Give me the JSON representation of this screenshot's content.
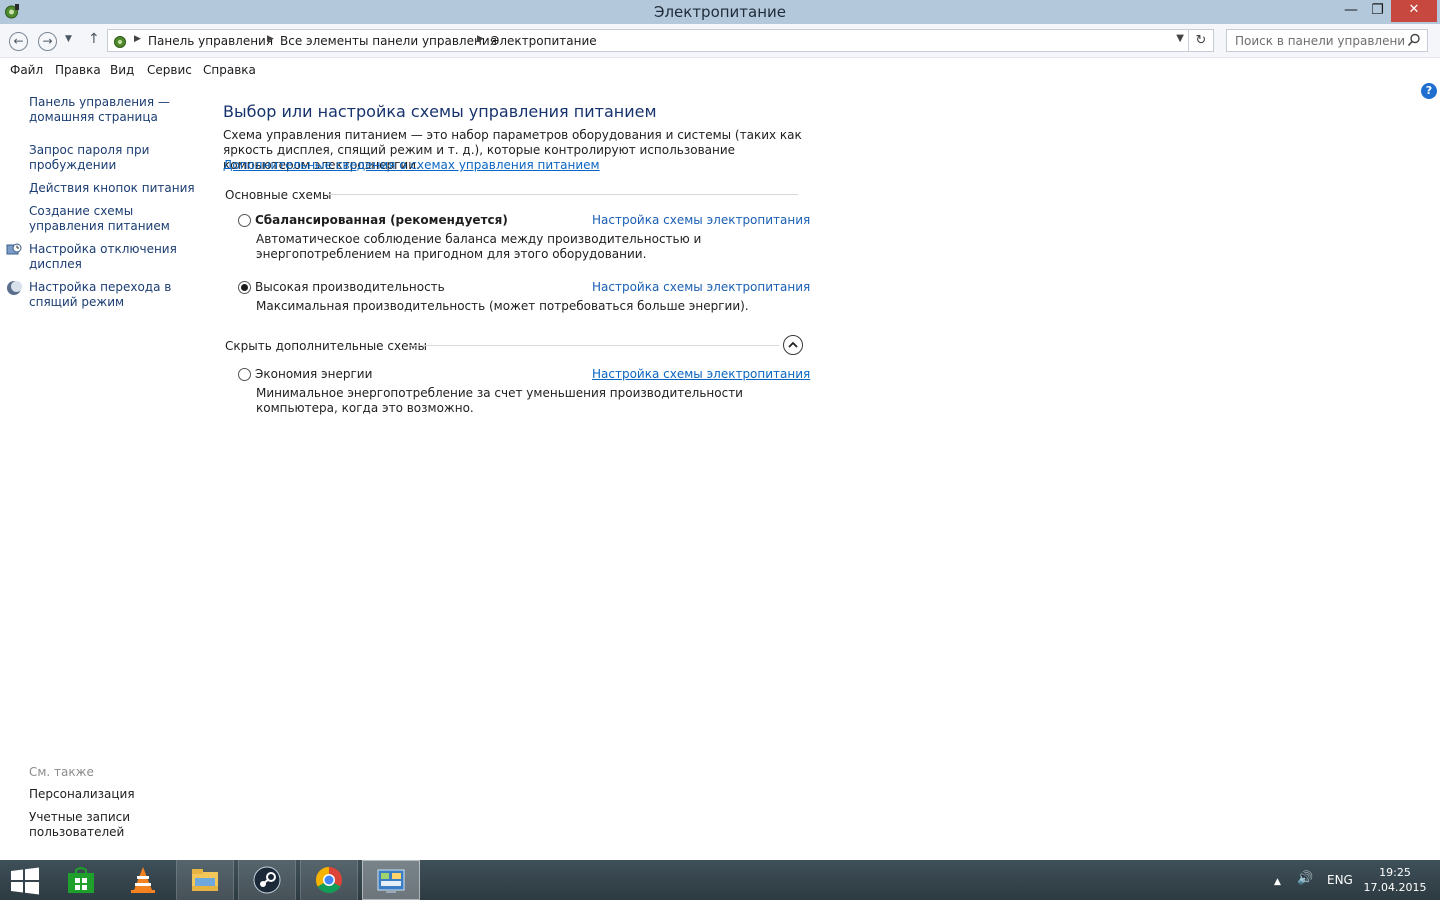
{
  "window": {
    "title": "Электропитание"
  },
  "controls": {
    "minimize": "—",
    "maximize": "❐",
    "close": "✕"
  },
  "address": {
    "crumbs": [
      "Панель управления",
      "Все элементы панели управления",
      "Электропитание"
    ],
    "search_placeholder": "Поиск в панели управления"
  },
  "menu": [
    "Файл",
    "Правка",
    "Вид",
    "Сервис",
    "Справка"
  ],
  "sidebar": {
    "links": [
      {
        "label": "Панель управления — домашняя страница"
      },
      {
        "label": "Запрос пароля при пробуждении"
      },
      {
        "label": "Действия кнопок питания"
      },
      {
        "label": "Создание схемы управления питанием"
      },
      {
        "label": "Настройка отключения дисплея",
        "icon": "display-clock-icon"
      },
      {
        "label": "Настройка перехода в спящий режим",
        "icon": "moon-icon"
      }
    ],
    "see_also_title": "См. также",
    "see_also": [
      "Персонализация",
      "Учетные записи пользователей"
    ]
  },
  "main": {
    "heading": "Выбор или настройка схемы управления питанием",
    "description": "Схема управления питанием — это набор параметров оборудования и системы (таких как яркость дисплея, спящий режим и т. д.), которые контролируют использование компьютером электроэнергии.",
    "more_link": "Дополнительные сведения о схемах управления питанием",
    "primary_group": "Основные схемы",
    "hidden_group": "Скрыть дополнительные схемы",
    "change_link": "Настройка схемы электропитания",
    "plans": [
      {
        "name": "Сбалансированная (рекомендуется)",
        "description": "Автоматическое соблюдение баланса между производительностью и энергопотреблением на пригодном для этого оборудовании.",
        "selected": false
      },
      {
        "name": "Высокая производительность",
        "description": "Максимальная производительность (может потребоваться больше энергии).",
        "selected": true
      },
      {
        "name": "Экономия энергии",
        "description": "Минимальное энергопотребление за счет уменьшения производительности компьютера, когда это возможно.",
        "selected": false
      }
    ]
  },
  "taskbar": {
    "apps": [
      "start-icon",
      "store-icon",
      "vlc-icon",
      "file-explorer-icon",
      "steam-icon",
      "chrome-icon",
      "control-panel-icon"
    ],
    "tray": {
      "language": "ENG",
      "time": "19:25",
      "date": "17.04.2015"
    }
  }
}
